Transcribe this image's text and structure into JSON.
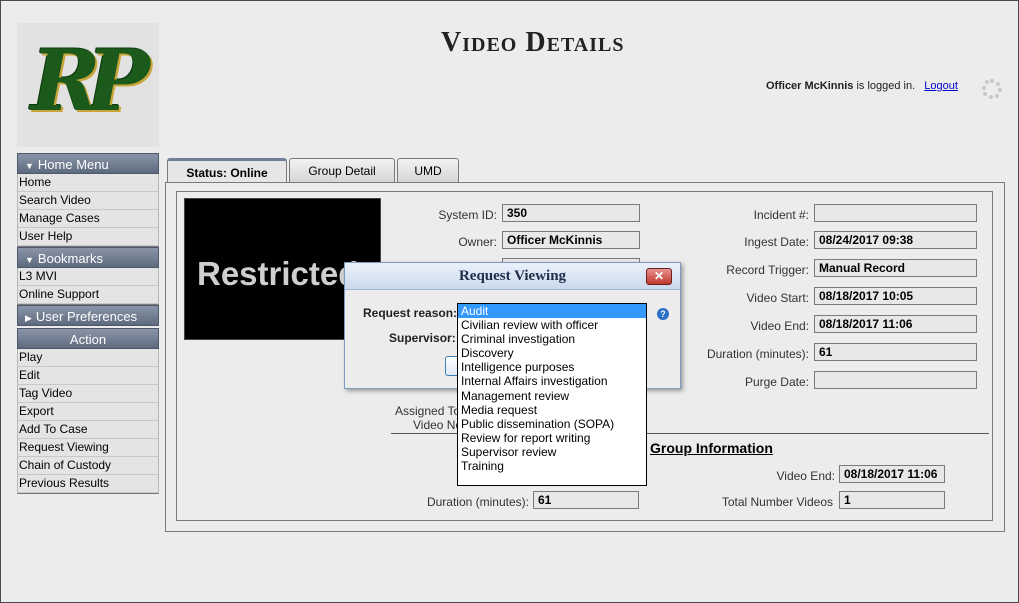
{
  "header": {
    "page_title": "Video Details",
    "logo_text": "RP",
    "login_user": "Officer McKinnis",
    "login_suffix": "is logged in.",
    "logout_label": "Logout"
  },
  "sidebar": {
    "home_menu": {
      "title": "Home Menu",
      "items": [
        "Home",
        "Search Video",
        "Manage Cases",
        "User Help"
      ]
    },
    "bookmarks": {
      "title": "Bookmarks",
      "items": [
        "L3 MVI",
        "Online Support"
      ]
    },
    "user_prefs": {
      "title": "User Preferences"
    },
    "action": {
      "title": "Action",
      "items": [
        "Play",
        "Edit",
        "Tag Video",
        "Export",
        "Add To Case",
        "Request Viewing",
        "Chain of Custody",
        "Previous Results"
      ]
    }
  },
  "tabs": [
    "Status: Online",
    "Group Detail",
    "UMD"
  ],
  "video": {
    "overlay_text": "Restricted"
  },
  "fields": {
    "system_id": {
      "label": "System ID:",
      "value": "350"
    },
    "owner": {
      "label": "Owner:",
      "value": "Officer McKinnis"
    },
    "incident": {
      "label": "Incident #:",
      "value": ""
    },
    "ingest_date": {
      "label": "Ingest Date:",
      "value": "08/24/2017 09:38"
    },
    "record_trigger": {
      "label": "Record Trigger:",
      "value": "Manual Record"
    },
    "video_start": {
      "label": "Video Start:",
      "value": "08/18/2017 10:05"
    },
    "video_end": {
      "label": "Video End:",
      "value": "08/18/2017 11:06"
    },
    "duration": {
      "label": "Duration (minutes):",
      "value": "61"
    },
    "purge_date": {
      "label": "Purge Date:",
      "value": ""
    },
    "assigned_to": {
      "label": "Assigned To"
    },
    "video_notes": {
      "label": "Video No"
    }
  },
  "group": {
    "title": "Group Information",
    "video_end": {
      "label": "Video End:",
      "value": "08/18/2017 11:06"
    },
    "duration": {
      "label": "Duration (minutes):",
      "value": "61"
    },
    "total_videos": {
      "label": "Total Number Videos",
      "value": "1"
    }
  },
  "dialog": {
    "title": "Request Viewing",
    "close_label": "✕",
    "reason_label": "Request reason:",
    "supervisor_label": "Supervisor:",
    "help_label": "?",
    "reason_options": [
      "Audit",
      "Civilian review with officer",
      "Criminal investigation",
      "Discovery",
      "Intelligence purposes",
      "Internal Affairs investigation",
      "Management review",
      "Media request",
      "Public dissemination (SOPA)",
      "Review for report writing",
      "Supervisor review",
      "Training"
    ],
    "selected_reason": "Audit"
  }
}
